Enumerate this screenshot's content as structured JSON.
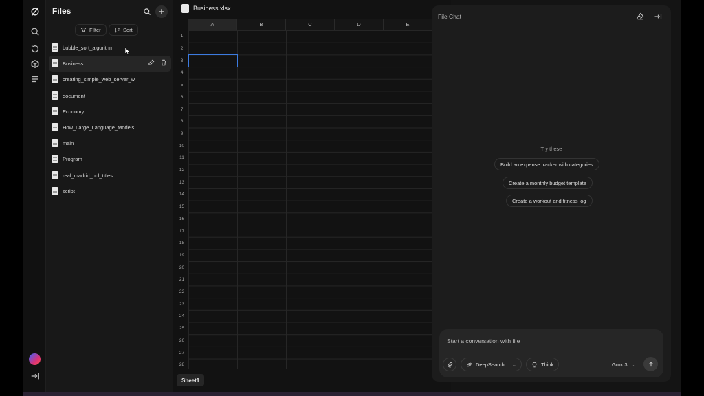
{
  "rail": {
    "icons": [
      "logo-icon",
      "search-icon",
      "history-icon",
      "box-icon",
      "list-icon",
      "collapse-icon"
    ]
  },
  "files": {
    "title": "Files",
    "filter_label": "Filter",
    "sort_label": "Sort",
    "items": [
      {
        "name": "bubble_sort_algorithm"
      },
      {
        "name": "Business"
      },
      {
        "name": "creating_simple_web_server_w"
      },
      {
        "name": "document"
      },
      {
        "name": "Economy"
      },
      {
        "name": "How_Large_Language_Models"
      },
      {
        "name": "main"
      },
      {
        "name": "Program"
      },
      {
        "name": "real_madrid_ucl_titles"
      },
      {
        "name": "script"
      }
    ],
    "active_index": 1
  },
  "sheet": {
    "filename": "Business.xlsx",
    "columns": [
      "A",
      "B",
      "C",
      "D",
      "E"
    ],
    "rows": [
      "1",
      "2",
      "3",
      "4",
      "5",
      "6",
      "7",
      "8",
      "9",
      "10",
      "11",
      "12",
      "13",
      "14",
      "15",
      "16",
      "17",
      "18",
      "19",
      "20",
      "21",
      "22",
      "23",
      "24",
      "25",
      "26",
      "27",
      "28"
    ],
    "selected_column": "A",
    "selected_cell": "A3",
    "tab": "Sheet1"
  },
  "chat": {
    "title": "File Chat",
    "try_label": "Try these",
    "suggestions": [
      "Build an expense tracker with categories",
      "Create a monthly budget template",
      "Create a workout and fitness log"
    ],
    "placeholder": "Start a conversation with file",
    "deepsearch_label": "DeepSearch",
    "think_label": "Think",
    "model_label": "Grok 3"
  }
}
